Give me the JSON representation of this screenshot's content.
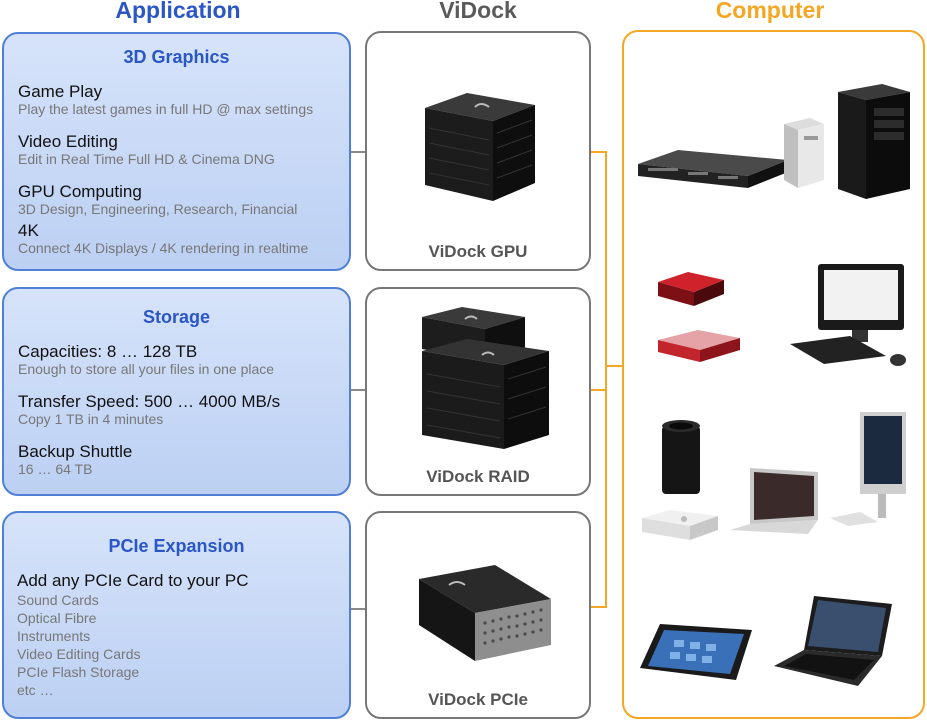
{
  "columns": {
    "application": "Application",
    "vidock": "ViDock",
    "computer": "Computer"
  },
  "colors": {
    "application_accent": "#2a56c6",
    "vidock_title": "#555555",
    "computer_accent": "#f5a623"
  },
  "graphics": {
    "title": "3D Graphics",
    "items": [
      {
        "title": "Game Play",
        "sub": "Play the latest games in full HD @ max settings"
      },
      {
        "title": "Video Editing",
        "sub": "Edit in Real Time Full HD & Cinema DNG"
      },
      {
        "title": "GPU Computing",
        "sub": "3D Design, Engineering, Research, Financial"
      },
      {
        "title": "4K",
        "sub": "Connect 4K Displays / 4K rendering in realtime"
      }
    ]
  },
  "storage": {
    "title": "Storage",
    "items": [
      {
        "title": "Capacities: 8 … 128 TB",
        "sub": "Enough to store all your files in one place"
      },
      {
        "title": "Transfer Speed: 500 … 4000 MB/s",
        "sub": "Copy 1 TB in 4 minutes"
      },
      {
        "title": "Backup Shuttle",
        "sub": "16 … 64 TB"
      }
    ]
  },
  "pcie": {
    "title": "PCIe Expansion",
    "headline": "Add any PCIe Card to your PC",
    "list": [
      "Sound Cards",
      "Optical Fibre",
      "Instruments",
      "Video Editing Cards",
      "PCIe Flash Storage",
      "etc …"
    ]
  },
  "products": [
    {
      "label": "ViDock GPU",
      "icon": "vidock-gpu-enclosure"
    },
    {
      "label": "ViDock RAID",
      "icon": "vidock-raid-enclosure"
    },
    {
      "label": "ViDock PCIe",
      "icon": "vidock-pcie-enclosure"
    }
  ],
  "computers": [
    {
      "icon": "rack-server-icon"
    },
    {
      "icon": "small-desktop-tower-icon"
    },
    {
      "icon": "tower-pc-icon"
    },
    {
      "icon": "mini-pc-red-icon"
    },
    {
      "icon": "mini-pc-red-flat-icon"
    },
    {
      "icon": "all-in-one-pc-icon"
    },
    {
      "icon": "mac-pro-icon"
    },
    {
      "icon": "mac-mini-icon"
    },
    {
      "icon": "macbook-icon"
    },
    {
      "icon": "imac-icon"
    },
    {
      "icon": "tablet-icon"
    },
    {
      "icon": "laptop-icon"
    }
  ]
}
